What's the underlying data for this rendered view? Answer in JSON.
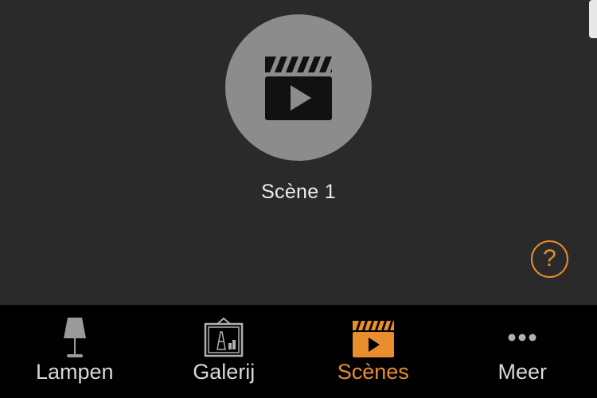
{
  "scenes": [
    {
      "label": "Scène 1",
      "icon": "clapperboard-play-icon"
    }
  ],
  "help": {
    "glyph": "?",
    "icon": "help-circle-icon"
  },
  "tabbar": {
    "tabs": [
      {
        "label": "Lampen",
        "icon": "lamp-icon",
        "active": false
      },
      {
        "label": "Galerij",
        "icon": "gallery-picture-icon",
        "active": false
      },
      {
        "label": "Scènes",
        "icon": "clapperboard-icon",
        "active": true
      },
      {
        "label": "Meer",
        "icon": "more-dots-icon",
        "active": false
      }
    ]
  },
  "colors": {
    "background": "#2a2a2a",
    "tabbar": "#000000",
    "accent": "#e88e2e",
    "scene_circle": "#8c8c8c",
    "text": "#ececec"
  }
}
